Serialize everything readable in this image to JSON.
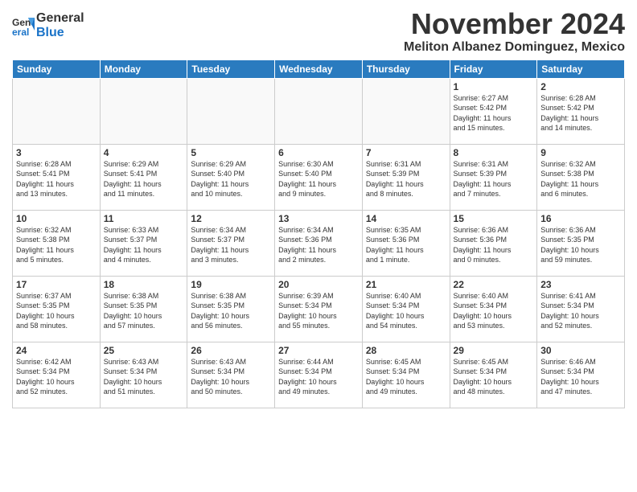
{
  "logo": {
    "text_general": "General",
    "text_blue": "Blue"
  },
  "header": {
    "month": "November 2024",
    "location": "Meliton Albanez Dominguez, Mexico"
  },
  "weekdays": [
    "Sunday",
    "Monday",
    "Tuesday",
    "Wednesday",
    "Thursday",
    "Friday",
    "Saturday"
  ],
  "weeks": [
    [
      {
        "day": "",
        "info": ""
      },
      {
        "day": "",
        "info": ""
      },
      {
        "day": "",
        "info": ""
      },
      {
        "day": "",
        "info": ""
      },
      {
        "day": "",
        "info": ""
      },
      {
        "day": "1",
        "info": "Sunrise: 6:27 AM\nSunset: 5:42 PM\nDaylight: 11 hours\nand 15 minutes."
      },
      {
        "day": "2",
        "info": "Sunrise: 6:28 AM\nSunset: 5:42 PM\nDaylight: 11 hours\nand 14 minutes."
      }
    ],
    [
      {
        "day": "3",
        "info": "Sunrise: 6:28 AM\nSunset: 5:41 PM\nDaylight: 11 hours\nand 13 minutes."
      },
      {
        "day": "4",
        "info": "Sunrise: 6:29 AM\nSunset: 5:41 PM\nDaylight: 11 hours\nand 11 minutes."
      },
      {
        "day": "5",
        "info": "Sunrise: 6:29 AM\nSunset: 5:40 PM\nDaylight: 11 hours\nand 10 minutes."
      },
      {
        "day": "6",
        "info": "Sunrise: 6:30 AM\nSunset: 5:40 PM\nDaylight: 11 hours\nand 9 minutes."
      },
      {
        "day": "7",
        "info": "Sunrise: 6:31 AM\nSunset: 5:39 PM\nDaylight: 11 hours\nand 8 minutes."
      },
      {
        "day": "8",
        "info": "Sunrise: 6:31 AM\nSunset: 5:39 PM\nDaylight: 11 hours\nand 7 minutes."
      },
      {
        "day": "9",
        "info": "Sunrise: 6:32 AM\nSunset: 5:38 PM\nDaylight: 11 hours\nand 6 minutes."
      }
    ],
    [
      {
        "day": "10",
        "info": "Sunrise: 6:32 AM\nSunset: 5:38 PM\nDaylight: 11 hours\nand 5 minutes."
      },
      {
        "day": "11",
        "info": "Sunrise: 6:33 AM\nSunset: 5:37 PM\nDaylight: 11 hours\nand 4 minutes."
      },
      {
        "day": "12",
        "info": "Sunrise: 6:34 AM\nSunset: 5:37 PM\nDaylight: 11 hours\nand 3 minutes."
      },
      {
        "day": "13",
        "info": "Sunrise: 6:34 AM\nSunset: 5:36 PM\nDaylight: 11 hours\nand 2 minutes."
      },
      {
        "day": "14",
        "info": "Sunrise: 6:35 AM\nSunset: 5:36 PM\nDaylight: 11 hours\nand 1 minute."
      },
      {
        "day": "15",
        "info": "Sunrise: 6:36 AM\nSunset: 5:36 PM\nDaylight: 11 hours\nand 0 minutes."
      },
      {
        "day": "16",
        "info": "Sunrise: 6:36 AM\nSunset: 5:35 PM\nDaylight: 10 hours\nand 59 minutes."
      }
    ],
    [
      {
        "day": "17",
        "info": "Sunrise: 6:37 AM\nSunset: 5:35 PM\nDaylight: 10 hours\nand 58 minutes."
      },
      {
        "day": "18",
        "info": "Sunrise: 6:38 AM\nSunset: 5:35 PM\nDaylight: 10 hours\nand 57 minutes."
      },
      {
        "day": "19",
        "info": "Sunrise: 6:38 AM\nSunset: 5:35 PM\nDaylight: 10 hours\nand 56 minutes."
      },
      {
        "day": "20",
        "info": "Sunrise: 6:39 AM\nSunset: 5:34 PM\nDaylight: 10 hours\nand 55 minutes."
      },
      {
        "day": "21",
        "info": "Sunrise: 6:40 AM\nSunset: 5:34 PM\nDaylight: 10 hours\nand 54 minutes."
      },
      {
        "day": "22",
        "info": "Sunrise: 6:40 AM\nSunset: 5:34 PM\nDaylight: 10 hours\nand 53 minutes."
      },
      {
        "day": "23",
        "info": "Sunrise: 6:41 AM\nSunset: 5:34 PM\nDaylight: 10 hours\nand 52 minutes."
      }
    ],
    [
      {
        "day": "24",
        "info": "Sunrise: 6:42 AM\nSunset: 5:34 PM\nDaylight: 10 hours\nand 52 minutes."
      },
      {
        "day": "25",
        "info": "Sunrise: 6:43 AM\nSunset: 5:34 PM\nDaylight: 10 hours\nand 51 minutes."
      },
      {
        "day": "26",
        "info": "Sunrise: 6:43 AM\nSunset: 5:34 PM\nDaylight: 10 hours\nand 50 minutes."
      },
      {
        "day": "27",
        "info": "Sunrise: 6:44 AM\nSunset: 5:34 PM\nDaylight: 10 hours\nand 49 minutes."
      },
      {
        "day": "28",
        "info": "Sunrise: 6:45 AM\nSunset: 5:34 PM\nDaylight: 10 hours\nand 49 minutes."
      },
      {
        "day": "29",
        "info": "Sunrise: 6:45 AM\nSunset: 5:34 PM\nDaylight: 10 hours\nand 48 minutes."
      },
      {
        "day": "30",
        "info": "Sunrise: 6:46 AM\nSunset: 5:34 PM\nDaylight: 10 hours\nand 47 minutes."
      }
    ]
  ]
}
